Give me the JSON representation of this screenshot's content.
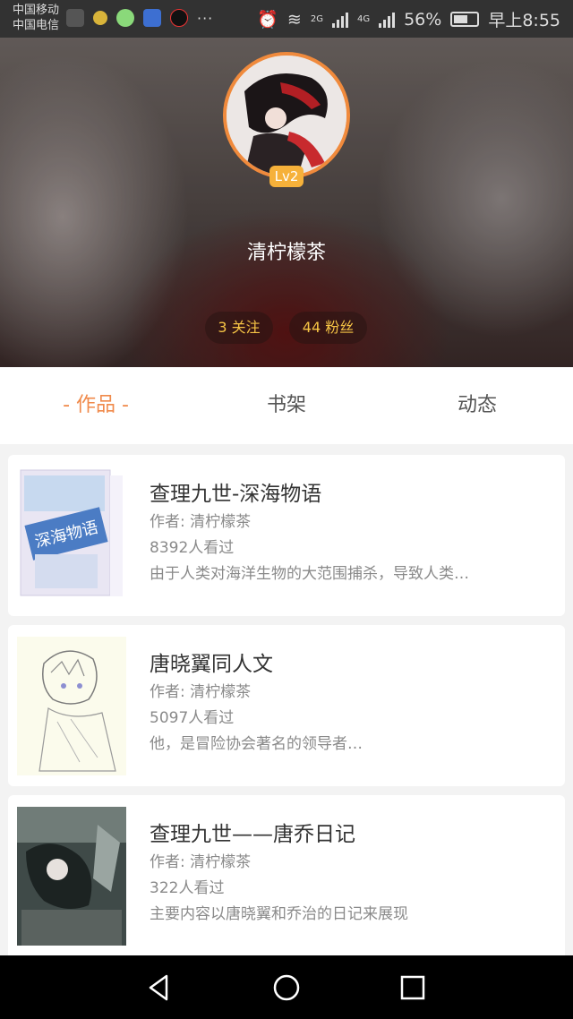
{
  "status_bar": {
    "carrier_1": "中国移动",
    "carrier_2": "中国电信",
    "net_2g": "2G",
    "net_4g": "4G",
    "battery": "56%",
    "time": "早上8:55",
    "more": "···"
  },
  "profile": {
    "level": "Lv2",
    "username": "清柠檬茶",
    "following": "3 关注",
    "fans": "44 粉丝"
  },
  "tabs": [
    {
      "label": "- 作品 -",
      "active": true
    },
    {
      "label": "书架",
      "active": false
    },
    {
      "label": "动态",
      "active": false
    }
  ],
  "works": [
    {
      "title": "查理九世-深海物语",
      "author": "作者: 清柠檬茶",
      "views": "8392人看过",
      "desc": "由于人类对海洋生物的大范围捕杀，导致人类…",
      "cover_text": "深海物语"
    },
    {
      "title": "唐晓翼同人文",
      "author": "作者: 清柠檬茶",
      "views": "5097人看过",
      "desc": "他，是冒险协会著名的领导者…"
    },
    {
      "title": "查理九世——唐乔日记",
      "author": "作者: 清柠檬茶",
      "views": "322人看过",
      "desc": "主要内容以唐晓翼和乔治的日记来展现"
    }
  ],
  "colors": {
    "accent": "#f08a4b",
    "badge": "#f6b13a",
    "stat_text": "#f6c445"
  },
  "nav_icons": [
    "back-icon",
    "home-icon",
    "recent-apps-icon"
  ]
}
